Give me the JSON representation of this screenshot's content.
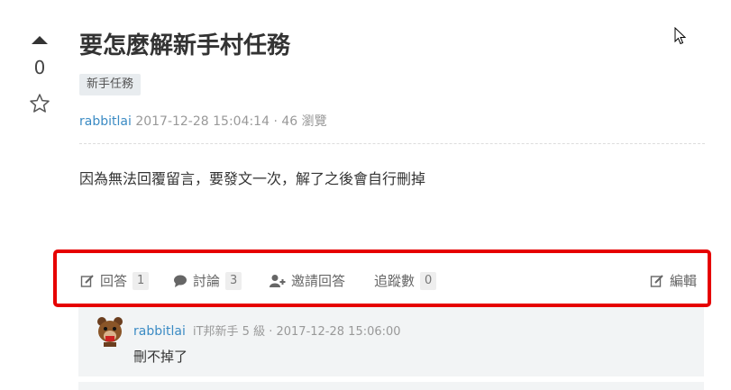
{
  "vote": {
    "count": "0"
  },
  "question": {
    "title": "要怎麼解新手村任務",
    "tag": "新手任務",
    "author": "rabbitlai",
    "datetime": "2017-12-28 15:04:14",
    "separator": "·",
    "views": "46 瀏覽",
    "body": "因為無法回覆留言，要發文一次，解了之後會自行刪掉"
  },
  "actions": {
    "answer_label": "回答",
    "answer_count": "1",
    "discuss_label": "討論",
    "discuss_count": "3",
    "invite_label": "邀請回答",
    "follow_label": "追蹤數",
    "follow_count": "0",
    "edit_label": "編輯"
  },
  "comment": {
    "author": "rabbitlai",
    "info": "iT邦新手 5 級 · 2017-12-28 15:06:00",
    "text": "刪不掉了"
  },
  "colors": {
    "link": "#3b8bc4",
    "highlight": "#e60000"
  }
}
